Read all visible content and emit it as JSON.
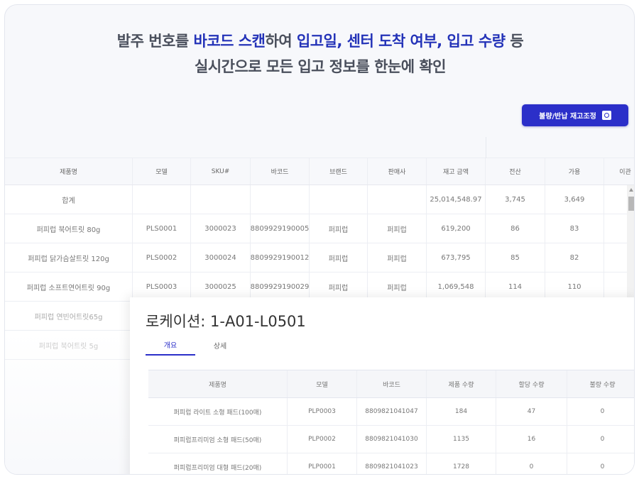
{
  "headline": {
    "line1_a": "발주 번호를 ",
    "line1_b": "바코드 스캔",
    "line1_c": "하여 ",
    "line1_d": "입고일, 센터 도착 여부, 입고 수량",
    "line1_e": " 등",
    "line2": "실시간으로 모든 입고 정보를 한눈에 확인"
  },
  "adjust_button": {
    "label": "불량/반납 재고조정",
    "icon": "settings-icon"
  },
  "table": {
    "columns": [
      "제품명",
      "모델",
      "SKU#",
      "바코드",
      "브랜드",
      "판매사",
      "재고 금액",
      "전산",
      "가용",
      "이관"
    ],
    "total_row": [
      "합계",
      "",
      "",
      "",
      "",
      "",
      "25,014,548.97",
      "3,745",
      "3,649",
      ""
    ],
    "rows": [
      [
        "퍼피럽 북어트릿 80g",
        "PLS0001",
        "3000023",
        "8809929190005",
        "퍼피럽",
        "퍼피럽",
        "619,200",
        "86",
        "83",
        ""
      ],
      [
        "퍼피럽 닭가슴살트릿 120g",
        "PLS0002",
        "3000024",
        "8809929190012",
        "퍼피럽",
        "퍼피럽",
        "673,795",
        "85",
        "82",
        ""
      ],
      [
        "퍼피럽 소프트연어트릿 90g",
        "PLS0003",
        "3000025",
        "8809929190029",
        "퍼피럽",
        "퍼피럽",
        "1,069,548",
        "114",
        "110",
        ""
      ],
      [
        "퍼피럽 연빈어트릿65g",
        "",
        "",
        "",
        "",
        "",
        "",
        "",
        "",
        ""
      ],
      [
        "퍼피럽 북어트릿 5g",
        "",
        "",
        "",
        "",
        "",
        "",
        "",
        "",
        ""
      ]
    ]
  },
  "location_panel": {
    "title": "로케이션: 1-A01-L0501",
    "tabs": [
      "개요",
      "상세"
    ],
    "active_tab": "개요",
    "columns": [
      "제품명",
      "모델",
      "바코드",
      "제품 수량",
      "할당 수량",
      "불량 수량"
    ],
    "rows": [
      [
        "퍼피럽 라이트 소형 패드(100매)",
        "PLP0003",
        "8809821041047",
        "184",
        "47",
        "0"
      ],
      [
        "퍼피럽프리미엄 소형 패드(50매)",
        "PLP0002",
        "8809821041030",
        "1135",
        "16",
        "0"
      ],
      [
        "퍼피럽프리미엄 대형 패드(20매)",
        "PLP0001",
        "8809821041023",
        "1728",
        "0",
        "0"
      ]
    ]
  },
  "colors": {
    "accent": "#2b2fc9",
    "headline_highlight": "#2433b8"
  }
}
